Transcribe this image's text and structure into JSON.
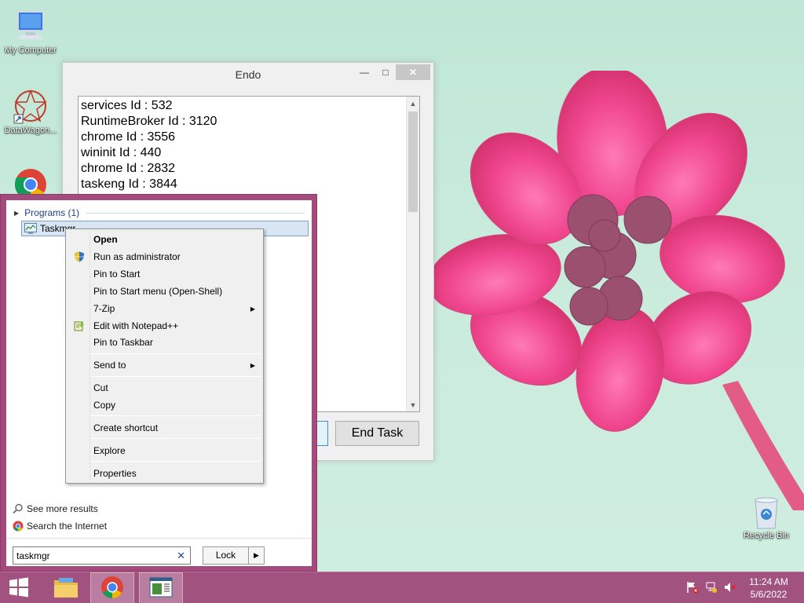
{
  "desktop": {
    "icons": [
      {
        "label": "My Computer"
      },
      {
        "label": "DataWagon..."
      },
      {
        "label": ""
      }
    ],
    "recycle_bin": "Recycle Bin"
  },
  "endo_window": {
    "title": "Endo",
    "minimize": "—",
    "maximize": "□",
    "close": "✕",
    "processes": [
      "services Id : 532",
      "RuntimeBroker Id : 3120",
      "chrome Id : 3556",
      "wininit Id : 440",
      "chrome Id : 2832",
      "taskeng Id : 3844"
    ],
    "end_task_label": "End Task"
  },
  "start_menu": {
    "group_label": "Programs (1)",
    "result_label": "Taskmgr",
    "see_more": "See more results",
    "search_internet": "Search the Internet",
    "search_value": "taskmgr",
    "clear_glyph": "✕",
    "lock_label": "Lock",
    "lock_arrow": "▶"
  },
  "context_menu": {
    "items": [
      {
        "label": "Open"
      },
      {
        "label": "Run as administrator"
      },
      {
        "label": "Pin to Start"
      },
      {
        "label": "Pin to Start menu (Open-Shell)"
      },
      {
        "label": "7-Zip"
      },
      {
        "label": "Edit with Notepad++"
      },
      {
        "label": "Pin to Taskbar"
      },
      {
        "label": "Send to"
      },
      {
        "label": "Cut"
      },
      {
        "label": "Copy"
      },
      {
        "label": "Create shortcut"
      },
      {
        "label": "Explore"
      },
      {
        "label": "Properties"
      }
    ],
    "submenu_arrow": "▶"
  },
  "taskbar": {
    "time": "11:24 AM",
    "date": "5/6/2022"
  },
  "colors": {
    "accent": "#a2527f",
    "menu_highlight": "#d8e6f4"
  }
}
